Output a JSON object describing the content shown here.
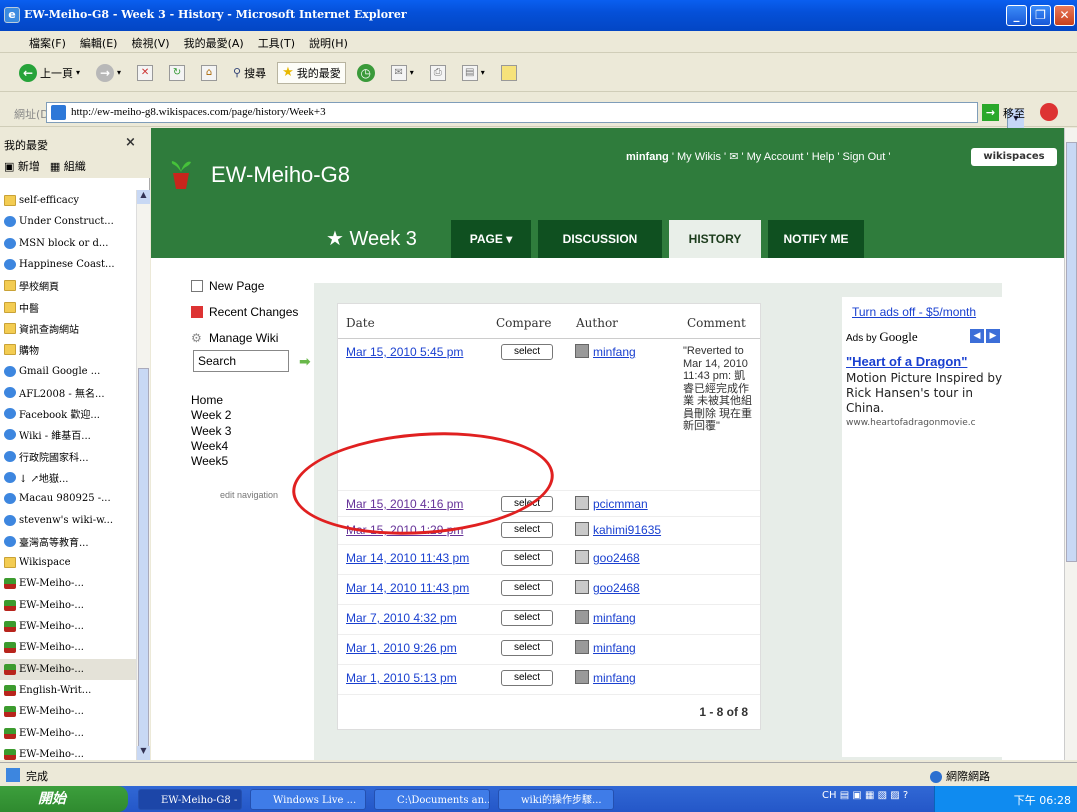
{
  "window": {
    "title": "EW-Meiho-G8 - Week 3 - History - Microsoft Internet Explorer"
  },
  "menu": [
    "檔案(F)",
    "編輯(E)",
    "檢視(V)",
    "我的最愛(A)",
    "工具(T)",
    "說明(H)"
  ],
  "toolbar": {
    "back": "上一頁",
    "search": "搜尋",
    "favorites": "我的最愛"
  },
  "address": {
    "label": "網址(D)",
    "url": "http://ew-meiho-g8.wikispaces.com/page/history/Week+3",
    "go": "移至"
  },
  "favorites": {
    "title": "我的最愛",
    "close": "×",
    "add": "新增",
    "organize": "組織",
    "items": [
      {
        "label": "self-efficacy",
        "icon": "folder"
      },
      {
        "label": "Under Construct...",
        "icon": "ie"
      },
      {
        "label": "MSN block or d...",
        "icon": "ie"
      },
      {
        "label": "Happinese Coast...",
        "icon": "ie"
      },
      {
        "label": "學校網頁",
        "icon": "folder"
      },
      {
        "label": "中醫",
        "icon": "folder"
      },
      {
        "label": "資訊查詢網站",
        "icon": "folder"
      },
      {
        "label": "購物",
        "icon": "folder"
      },
      {
        "label": "Gmail Google ...",
        "icon": "ie"
      },
      {
        "label": "AFL2008 - 無名...",
        "icon": "ie"
      },
      {
        "label": "Facebook 歡迎...",
        "icon": "ie"
      },
      {
        "label": "Wiki - 維基百...",
        "icon": "ie"
      },
      {
        "label": "行政院國家科...",
        "icon": "ie"
      },
      {
        "label": "↓ ↗地嶽...",
        "icon": "ie"
      },
      {
        "label": "Macau 980925 -...",
        "icon": "ie"
      },
      {
        "label": "stevenw's wiki-w...",
        "icon": "ie"
      },
      {
        "label": "臺灣高等教育...",
        "icon": "ie"
      },
      {
        "label": "Wikispace",
        "icon": "folder"
      },
      {
        "label": "EW-Meiho-...",
        "icon": "plant"
      },
      {
        "label": "EW-Meiho-...",
        "icon": "plant"
      },
      {
        "label": "EW-Meiho-...",
        "icon": "plant"
      },
      {
        "label": "EW-Meiho-...",
        "icon": "plant"
      },
      {
        "label": "EW-Meiho-...",
        "icon": "plant"
      },
      {
        "label": "English-Writ...",
        "icon": "plant"
      },
      {
        "label": "EW-Meiho-...",
        "icon": "plant"
      },
      {
        "label": "EW-Meiho-...",
        "icon": "plant"
      },
      {
        "label": "EW-Meiho-...",
        "icon": "plant"
      }
    ]
  },
  "site": {
    "name": "EW-Meiho-G8",
    "username": "minfang",
    "links": "' My Wikis ' ✉ ' My Account ' Help ' Sign Out '",
    "wikispaces": "wikispaces"
  },
  "page": {
    "title": "★ Week 3",
    "tabs": [
      "PAGE ▾",
      "DISCUSSION",
      "HISTORY",
      "NOTIFY ME"
    ]
  },
  "nav": {
    "new_page": "New Page",
    "recent_changes": "Recent Changes",
    "manage_wiki": "Manage Wiki",
    "search_placeholder": "Search",
    "links": [
      "Home",
      "Week 2",
      "Week 3",
      "Week4",
      "Week5"
    ],
    "edit_navigation": "edit navigation"
  },
  "history": {
    "headers": [
      "Date",
      "Compare",
      "Author",
      "Comment"
    ],
    "select_label": "select",
    "rows": [
      {
        "date": "Mar 15, 2010 5:45 pm",
        "author": "minfang",
        "comment": "\"Reverted to Mar 14, 2010 11:43 pm: 凱睿已經完成作業 未被其他組員刪除 現在重新回覆\""
      },
      {
        "date": "Mar 15, 2010 4:16 pm",
        "author": "pcicmman",
        "comment": ""
      },
      {
        "date": "Mar 15, 2010 1:29 pm",
        "author": "kahimi91635",
        "comment": ""
      },
      {
        "date": "Mar 14, 2010 11:43 pm",
        "author": "goo2468",
        "comment": ""
      },
      {
        "date": "Mar 14, 2010 11:43 pm",
        "author": "goo2468",
        "comment": ""
      },
      {
        "date": "Mar 7, 2010 4:32 pm",
        "author": "minfang",
        "comment": ""
      },
      {
        "date": "Mar 1, 2010 9:26 pm",
        "author": "minfang",
        "comment": ""
      },
      {
        "date": "Mar 1, 2010 5:13 pm",
        "author": "minfang",
        "comment": ""
      }
    ],
    "pager": "1 - 8 of 8"
  },
  "ads": {
    "turn_off": "Turn ads off - $5/month",
    "ads_by": "Ads by",
    "google": "Google",
    "title": "\"Heart of a Dragon\"",
    "body": "Motion Picture Inspired by Rick Hansen's tour in China.",
    "url": "www.heartofadragonmovie.c"
  },
  "status": {
    "text": "完成",
    "zone": "網際網路"
  },
  "taskbar": {
    "start": "開始",
    "tasks": [
      "EW-Meiho-G8 - ...",
      "Windows Live ...",
      "C:\\Documents an...",
      "wiki的操作步驟..."
    ],
    "lang": "CH",
    "clock": "下午 06:28"
  },
  "colors": {
    "header_green": "#2f7c3c",
    "link_blue": "#1a40d0",
    "annotation_red": "#e02020"
  }
}
